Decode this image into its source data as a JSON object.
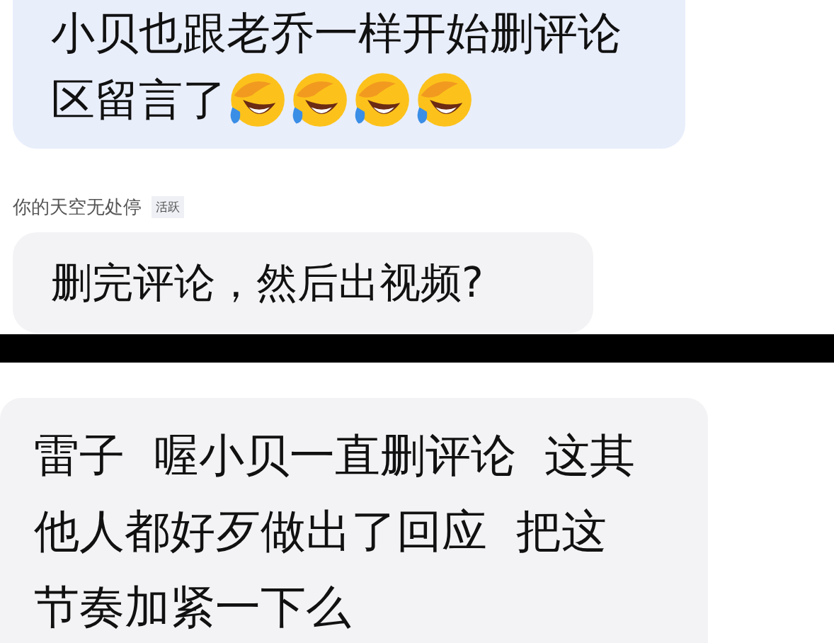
{
  "comments": [
    {
      "kind": "reply",
      "lines": [
        "小贝也跟老乔一样开始删评论",
        "区留言了"
      ],
      "emojis": [
        {
          "kind": "laughing-crying"
        },
        {
          "kind": "laughing-crying"
        },
        {
          "kind": "laughing-crying"
        },
        {
          "kind": "laughing-crying"
        }
      ],
      "color": "#e9eefb"
    },
    {
      "kind": "comment",
      "author": "你的天空无处停",
      "badge": "活跃",
      "text": "删完评论，然后出视频?",
      "color": "#f3f3f5"
    },
    {
      "kind": "divider"
    },
    {
      "kind": "comment",
      "text": "雷子  喔小贝一直删评论  这其他人都好歹做出了回应  把这节奏加紧一下么",
      "color": "#f3f3f5"
    }
  ]
}
